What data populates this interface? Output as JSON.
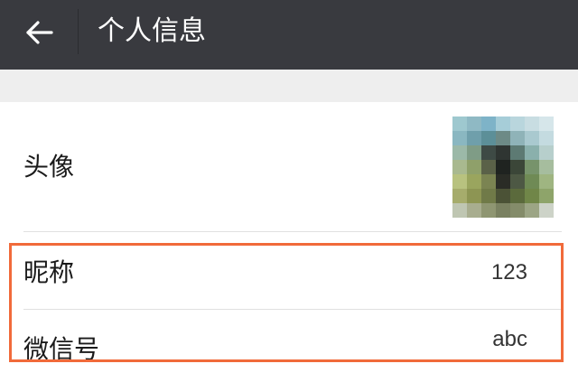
{
  "header": {
    "back_icon": "arrow-left-icon",
    "title": "个人信息"
  },
  "profile": {
    "avatar_label": "头像",
    "nickname_label": "昵称",
    "nickname_value": "123",
    "wechat_id_label": "微信号",
    "wechat_id_value": "abc"
  },
  "colors": {
    "header_bg": "#393a3f",
    "page_gap_bg": "#eeeeee",
    "highlight_border": "#f16a3a"
  }
}
